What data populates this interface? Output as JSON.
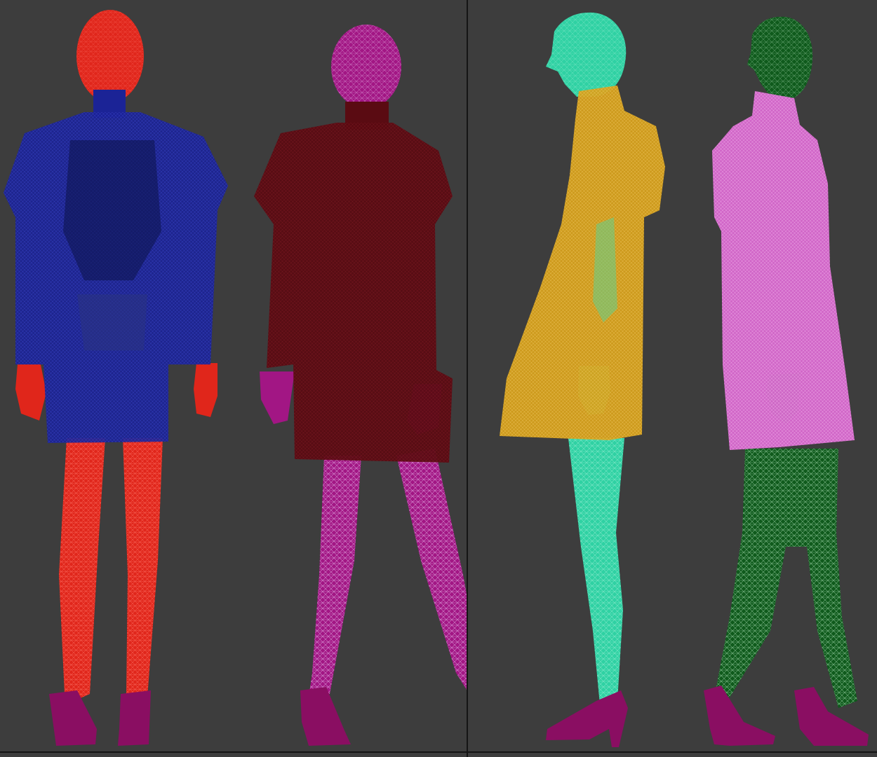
{
  "viewports": [
    {
      "id": "left",
      "view": "front"
    },
    {
      "id": "right",
      "view": "side"
    }
  ],
  "figures": [
    {
      "id": "fig1",
      "pose": "front",
      "body_color": "#e0261b",
      "garment_color": "#1b2396",
      "shoe_color": "#8a0e62"
    },
    {
      "id": "fig2",
      "pose": "back",
      "body_color": "#a21684",
      "garment_color": "#5a0b12",
      "shoe_color": "#8a0e62"
    },
    {
      "id": "fig3",
      "pose": "side",
      "body_color": "#2fd1a3",
      "garment_color": "#d6a01c",
      "shoe_color": "#8a0e62"
    },
    {
      "id": "fig4",
      "pose": "side",
      "body_color": "#0f5a1c",
      "garment_color": "#d96ad0",
      "shoe_color": "#8a0e62"
    }
  ],
  "colors": {
    "background": "#3d3d3d",
    "divider": "#151515"
  }
}
